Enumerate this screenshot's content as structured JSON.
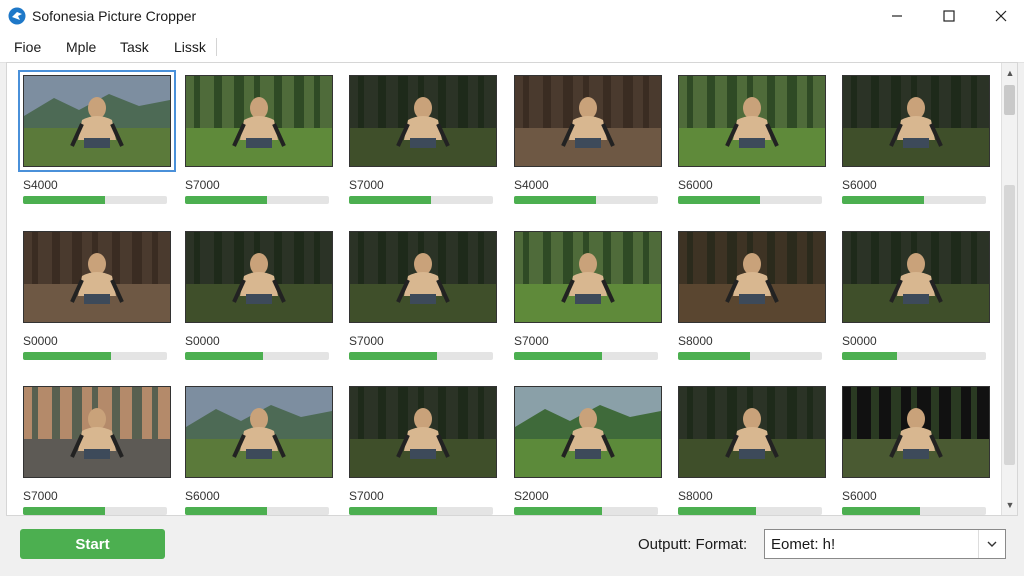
{
  "window": {
    "title": "Sofonesia Picture Cropper"
  },
  "menu": [
    {
      "label": "Fioe"
    },
    {
      "label": "Mple"
    },
    {
      "label": "Task"
    },
    {
      "label": "Lissk"
    }
  ],
  "tiles": [
    {
      "label": "S4000",
      "progress": 0.57,
      "scene": "mountain",
      "selected": true
    },
    {
      "label": "S7000",
      "progress": 0.57,
      "scene": "forest-light"
    },
    {
      "label": "S7000",
      "progress": 0.57,
      "scene": "forest-dark"
    },
    {
      "label": "S4000",
      "progress": 0.57,
      "scene": "cabin"
    },
    {
      "label": "S6000",
      "progress": 0.57,
      "scene": "forest-light"
    },
    {
      "label": "S6000",
      "progress": 0.57,
      "scene": "forest-dark"
    },
    {
      "label": "S0000",
      "progress": 0.61,
      "scene": "cabin"
    },
    {
      "label": "S0000",
      "progress": 0.54,
      "scene": "forest-dark"
    },
    {
      "label": "S7000",
      "progress": 0.61,
      "scene": "forest-dark"
    },
    {
      "label": "S7000",
      "progress": 0.61,
      "scene": "forest-light"
    },
    {
      "label": "S8000",
      "progress": 0.5,
      "scene": "forest-warm"
    },
    {
      "label": "S0000",
      "progress": 0.38,
      "scene": "forest-dark"
    },
    {
      "label": "S7000",
      "progress": 0.57,
      "scene": "road"
    },
    {
      "label": "S6000",
      "progress": 0.57,
      "scene": "mountain"
    },
    {
      "label": "S7000",
      "progress": 0.61,
      "scene": "forest-dark"
    },
    {
      "label": "S2000",
      "progress": 0.61,
      "scene": "meadow"
    },
    {
      "label": "S8000",
      "progress": 0.54,
      "scene": "forest-dark"
    },
    {
      "label": "S6000",
      "progress": 0.54,
      "scene": "forest-framed"
    }
  ],
  "footer": {
    "start_label": "Start",
    "format_label": "Outputt: Format:",
    "format_value": "Eomet:   h!"
  },
  "colors": {
    "accent": "#4caf50",
    "selection": "#4a90d9"
  },
  "icons": {
    "app": "bird-icon",
    "minimize": "minimize-icon",
    "maximize": "maximize-icon",
    "close": "close-icon",
    "dropdown": "chevron-down-icon"
  }
}
